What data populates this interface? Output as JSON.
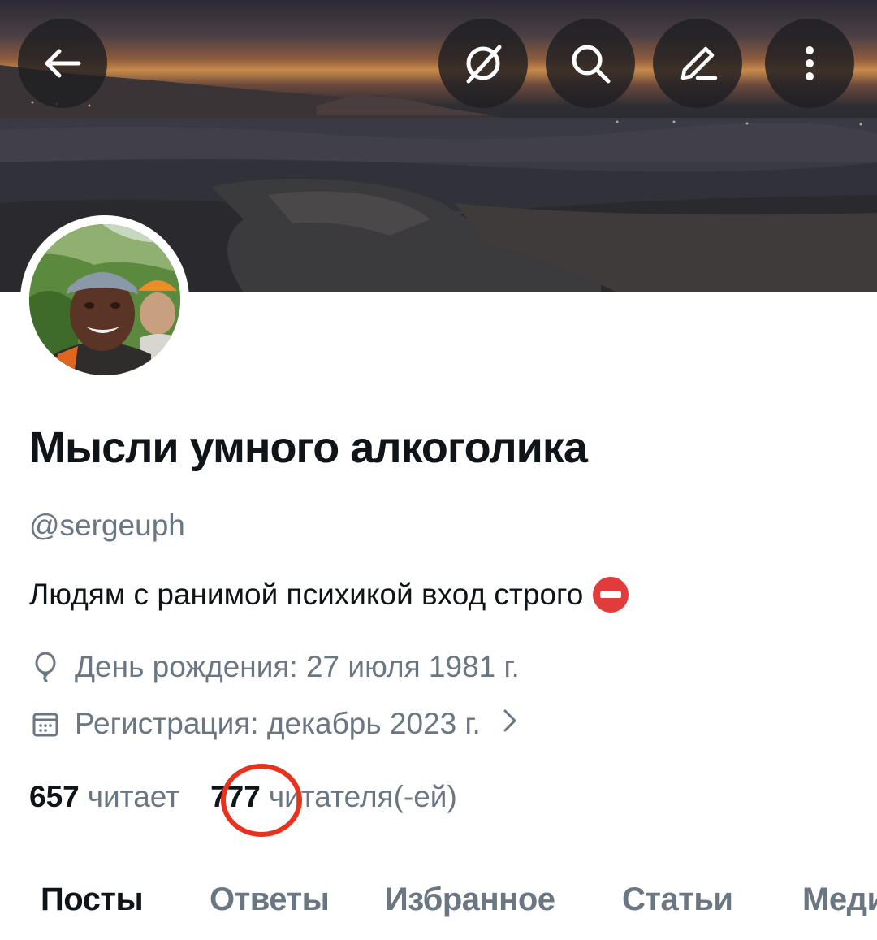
{
  "header": {
    "back_icon": "arrow-left-icon",
    "actions": [
      "grok-icon",
      "search-icon",
      "edit-icon",
      "more-vertical-icon"
    ]
  },
  "profile": {
    "name": "Мысли умного алкоголика",
    "handle": "@sergeuph",
    "bio": "Людям с ранимой психикой вход строго",
    "bio_emoji": "no-entry-icon",
    "birthday": "День рождения: 27 июля 1981 г.",
    "joined": "Регистрация: декабрь 2023 г."
  },
  "stats": {
    "following_count": "657",
    "following_label": "читает",
    "followers_count": "777",
    "followers_label": "читателя(-ей)"
  },
  "tabs": [
    {
      "label": "Посты",
      "active": true
    },
    {
      "label": "Ответы",
      "active": false
    },
    {
      "label": "Избранное",
      "active": false
    },
    {
      "label": "Статьи",
      "active": false
    },
    {
      "label": "Медиа",
      "active": false
    }
  ],
  "colors": {
    "text": "#0f1419",
    "secondary": "#6a7681",
    "highlight_circle": "#e8321e"
  }
}
